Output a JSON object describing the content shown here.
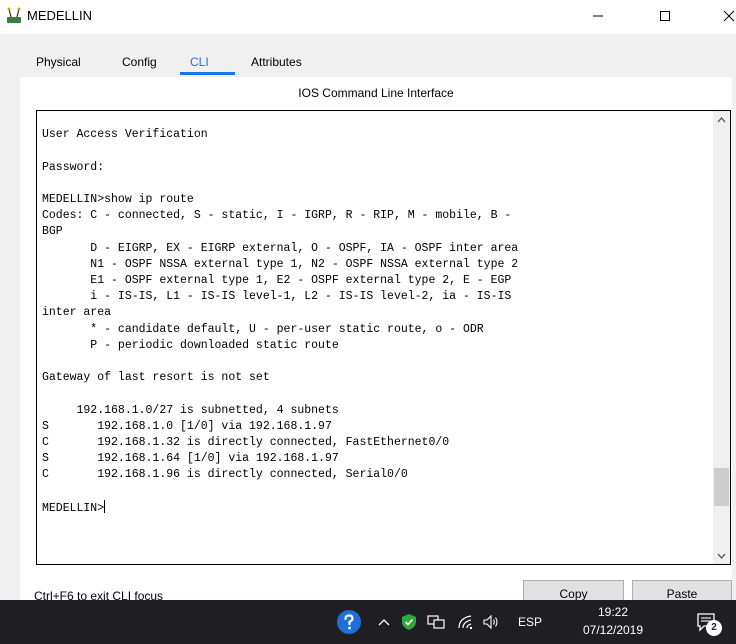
{
  "window": {
    "title": "MEDELLIN",
    "minimize_glyph": "—",
    "maximize_glyph": "☐",
    "close_glyph": "✕"
  },
  "tabs": [
    {
      "label": "Physical",
      "active": false
    },
    {
      "label": "Config",
      "active": false
    },
    {
      "label": "CLI",
      "active": true
    },
    {
      "label": "Attributes",
      "active": false
    }
  ],
  "pane_title": "IOS Command Line Interface",
  "terminal": {
    "lines": [
      "",
      "User Access Verification",
      "",
      "Password:",
      "",
      "MEDELLIN>show ip route",
      "Codes: C - connected, S - static, I - IGRP, R - RIP, M - mobile, B -",
      "BGP",
      "       D - EIGRP, EX - EIGRP external, O - OSPF, IA - OSPF inter area",
      "       N1 - OSPF NSSA external type 1, N2 - OSPF NSSA external type 2",
      "       E1 - OSPF external type 1, E2 - OSPF external type 2, E - EGP",
      "       i - IS-IS, L1 - IS-IS level-1, L2 - IS-IS level-2, ia - IS-IS",
      "inter area",
      "       * - candidate default, U - per-user static route, o - ODR",
      "       P - periodic downloaded static route",
      "",
      "Gateway of last resort is not set",
      "",
      "     192.168.1.0/27 is subnetted, 4 subnets",
      "S       192.168.1.0 [1/0] via 192.168.1.97",
      "C       192.168.1.32 is directly connected, FastEthernet0/0",
      "S       192.168.1.64 [1/0] via 192.168.1.97",
      "C       192.168.1.96 is directly connected, Serial0/0",
      ""
    ],
    "prompt": "MEDELLIN>"
  },
  "footer_hint": "Ctrl+F6 to exit CLI focus",
  "buttons": {
    "copy": "Copy",
    "paste": "Paste"
  },
  "taskbar": {
    "language": "ESP",
    "time": "19:22",
    "date": "07/12/2019",
    "notification_count": "2"
  },
  "colors": {
    "active_tab": "#1a74e8",
    "taskbar_bg": "#1f1f23",
    "window_bg": "#f0f0f0"
  },
  "icons": [
    "router-icon",
    "help-icon",
    "chevron-up-icon",
    "shield-check-icon",
    "network-icon",
    "wifi-icon",
    "volume-icon",
    "notification-icon"
  ]
}
